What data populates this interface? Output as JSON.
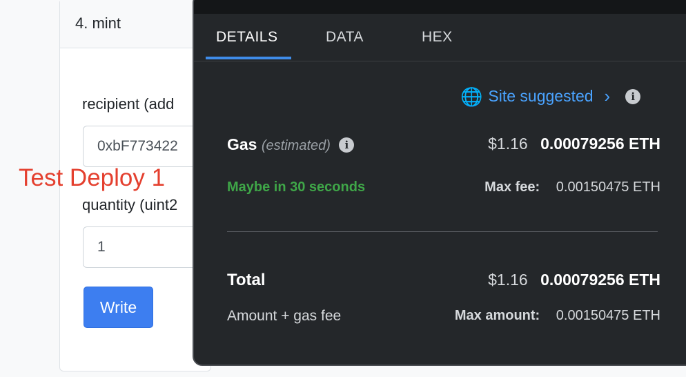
{
  "contract_form": {
    "section_title": "4. mint",
    "recipient_label": "recipient (add",
    "recipient_value": "0xbF773422",
    "quantity_label": "quantity (uint2",
    "quantity_value": "1",
    "write_button": "Write"
  },
  "annotation": {
    "text": "Test Deploy 1",
    "color": "#e4402f"
  },
  "wallet_popup": {
    "tabs": [
      {
        "label": "DETAILS",
        "active": true
      },
      {
        "label": "DATA",
        "active": false
      },
      {
        "label": "HEX",
        "active": false
      }
    ],
    "site_suggested": {
      "label": "Site suggested",
      "icon": "globe-icon"
    },
    "gas": {
      "label": "Gas",
      "qualifier": "(estimated)",
      "fiat": "$1.16",
      "eth": "0.00079256 ETH",
      "timing": "Maybe in 30 seconds",
      "max_fee_label": "Max fee:",
      "max_fee_value": "0.00150475 ETH"
    },
    "total": {
      "label": "Total",
      "fiat": "$1.16",
      "eth": "0.00079256 ETH",
      "sub_label": "Amount + gas fee",
      "max_amount_label": "Max amount:",
      "max_amount_value": "0.00150475 ETH"
    },
    "colors": {
      "accent": "#3f8ce9",
      "link": "#4aa3ff",
      "success": "#3fa648",
      "background": "#24272a"
    }
  }
}
